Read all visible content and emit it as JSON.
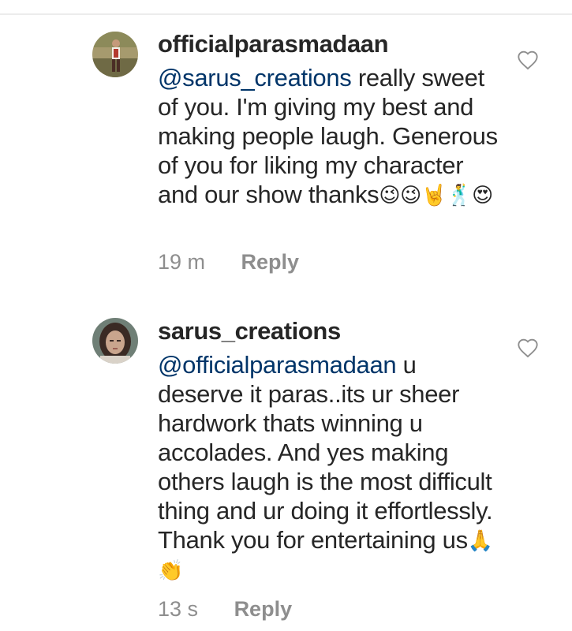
{
  "comments": [
    {
      "username": "officialparasmadaan",
      "mention": "@sarus_creations",
      "text": " really sweet of you. I'm giving my best and making people laugh. Generous of you for liking my character and our show thanks",
      "emojis": "😉😉🤘🕺😍",
      "time": "19 m",
      "reply_label": "Reply",
      "avatar_icon": "avatar-man-standing"
    },
    {
      "username": "sarus_creations",
      "mention": "@officialparasmadaan",
      "text": " u deserve it paras..its ur sheer hardwork thats winning u accolades.  And yes making others laugh is the most difficult thing and ur doing it effortlessly.  Thank you for entertaining us",
      "emojis": "🙏👏",
      "time": "13 s",
      "reply_label": "Reply",
      "avatar_icon": "avatar-woman-portrait"
    }
  ],
  "colors": {
    "mention": "#003569",
    "text": "#262626",
    "meta": "#8e8e8e",
    "like_outline": "#8e8e8e"
  },
  "icons": {
    "like": "heart-outline-icon"
  }
}
